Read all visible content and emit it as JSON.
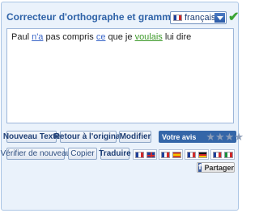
{
  "header": {
    "title": "Correcteur d'orthographe et grammaire",
    "language": "français",
    "status_icon": "check-icon"
  },
  "editor": {
    "segments": [
      {
        "text": "Paul ",
        "error": false
      },
      {
        "text": "n'a",
        "error": true,
        "color": "#3a66c8"
      },
      {
        "text": " pas compris ",
        "error": false
      },
      {
        "text": "ce",
        "error": true,
        "color": "#3a66c8"
      },
      {
        "text": " que je ",
        "error": false
      },
      {
        "text": "voulais",
        "error": true,
        "color": "#3d9a2a"
      },
      {
        "text": " lui dire",
        "error": false
      }
    ]
  },
  "toolbar": {
    "new_text": "Nouveau Texte",
    "revert": "Retour à l'original",
    "modify": "Modifier",
    "rating_label": "Votre avis",
    "verify_again": "Vérifier de nouveau",
    "copy": "Copier",
    "translate": "Traduire",
    "share": "Partager"
  },
  "translations": [
    {
      "from": "fr",
      "to": "gb"
    },
    {
      "from": "fr",
      "to": "es"
    },
    {
      "from": "fr",
      "to": "de"
    },
    {
      "from": "fr",
      "to": "it"
    }
  ],
  "rating": {
    "stars": 4,
    "value": 0
  },
  "colors": {
    "accent": "#2f63a8",
    "panel": "#eaf2fb",
    "rating_bg": "#3466a8",
    "ok_green": "#3aa435"
  }
}
